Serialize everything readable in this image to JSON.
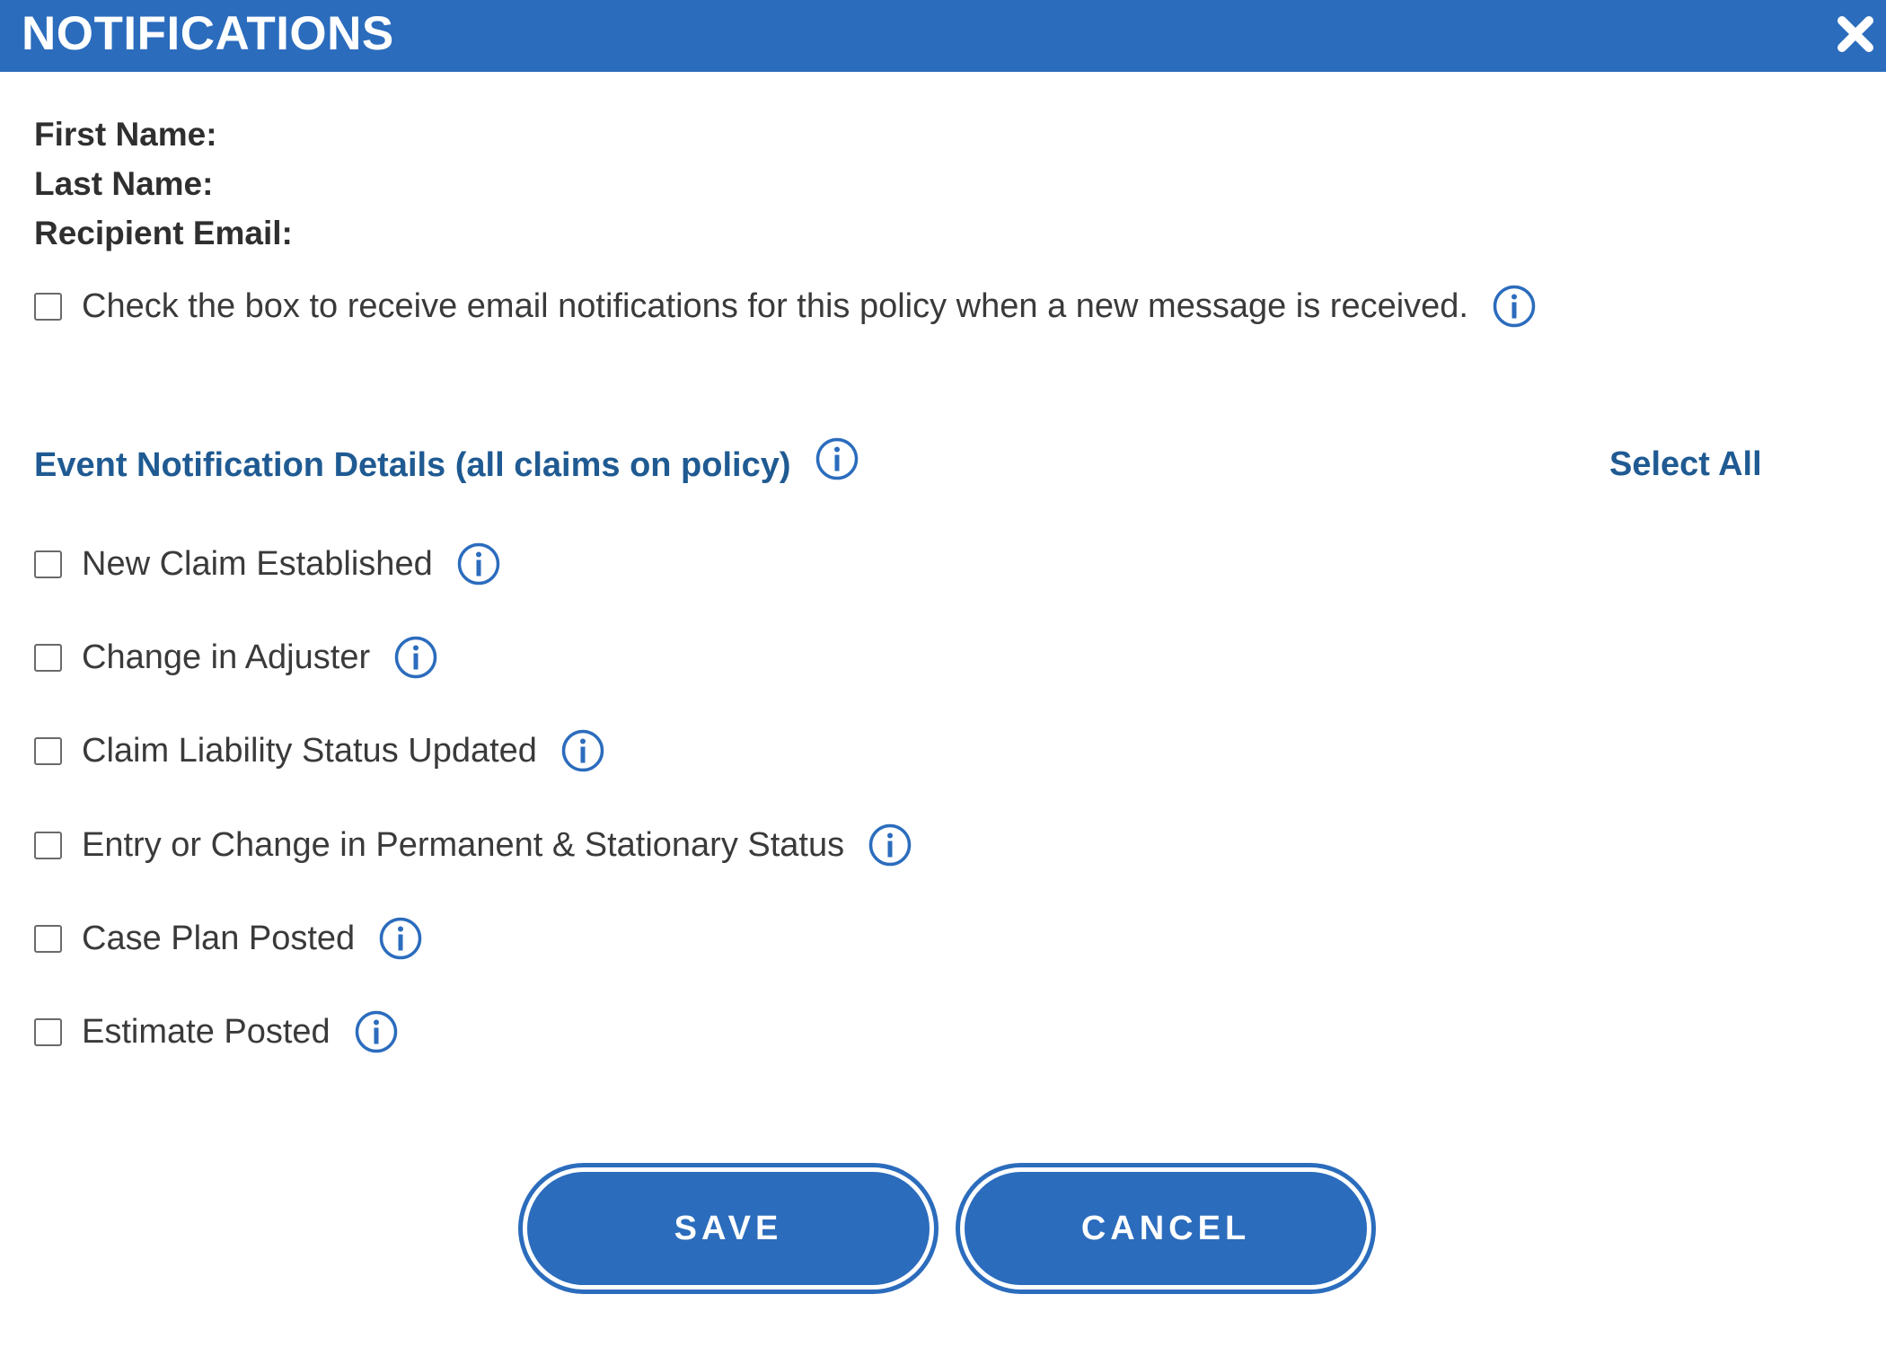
{
  "dialog": {
    "title": "NOTIFICATIONS",
    "close_icon": "close-icon"
  },
  "fields": {
    "first_name_label": "First Name:",
    "first_name_value": "",
    "last_name_label": "Last Name:",
    "last_name_value": "",
    "email_label": "Recipient Email:",
    "email_value": ""
  },
  "message_notification": {
    "label": "Check the box to receive email notifications for this policy when a new message is received.",
    "checked": false,
    "icon": "info-icon"
  },
  "event_section": {
    "title": "Event Notification Details (all claims on policy)",
    "select_all_label": "Select All",
    "items": [
      {
        "label": "New Claim Established",
        "checked": false
      },
      {
        "label": "Change in Adjuster",
        "checked": false
      },
      {
        "label": "Claim Liability Status Updated",
        "checked": false
      },
      {
        "label": "Entry or Change in Permanent & Stationary Status",
        "checked": false
      },
      {
        "label": "Case Plan Posted",
        "checked": false
      },
      {
        "label": "Estimate Posted",
        "checked": false
      }
    ]
  },
  "buttons": {
    "save_label": "SAVE",
    "cancel_label": "CANCEL"
  },
  "colors": {
    "primary": "#2b6cbd",
    "heading_blue": "#1f5a92",
    "text": "#3a3a3a"
  }
}
